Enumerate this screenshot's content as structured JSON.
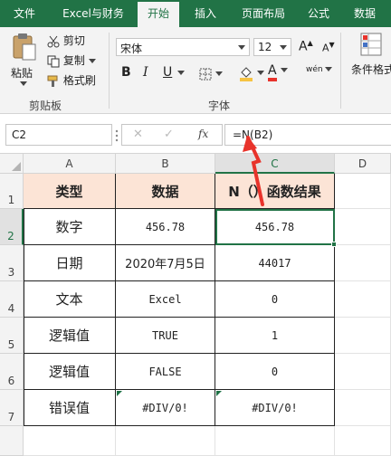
{
  "tabs": [
    "文件",
    "Excel与财务",
    "开始",
    "插入",
    "页面布局",
    "公式",
    "数据"
  ],
  "active_tab": "开始",
  "clipboard": {
    "paste_label": "粘贴",
    "cut_label": "剪切",
    "copy_label": "复制",
    "format_painter_label": "格式刷",
    "group_label": "剪贴板"
  },
  "font": {
    "font_name": "宋体",
    "font_size": "12",
    "grow_label": "A",
    "shrink_label": "A",
    "bold_label": "B",
    "italic_label": "I",
    "underline_label": "U",
    "font_color_label": "A",
    "phonetic_label": "wén",
    "group_label": "字体"
  },
  "styles": {
    "conditional_format_label": "条件格式"
  },
  "formula_bar": {
    "name_box": "C2",
    "cancel_label": "✕",
    "enter_label": "✓",
    "fx_label": "fx",
    "formula": "=N(B2)"
  },
  "columns": [
    "A",
    "B",
    "C",
    "D"
  ],
  "selected_column": "C",
  "rows": [
    "1",
    "2",
    "3",
    "4",
    "5",
    "6",
    "7"
  ],
  "selected_row": "2",
  "table": {
    "headers": [
      "类型",
      "数据",
      "N（）函数结果"
    ],
    "rows": [
      [
        "数字",
        "456.78",
        "456.78"
      ],
      [
        "日期",
        "2020年7月5日",
        "44017"
      ],
      [
        "文本",
        "Excel",
        "0"
      ],
      [
        "逻辑值",
        "TRUE",
        "1"
      ],
      [
        "逻辑值",
        "FALSE",
        "0"
      ],
      [
        "错误值",
        "#DIV/0!",
        "#DIV/0!"
      ]
    ]
  },
  "colors": {
    "accent": "#217346",
    "header_fill": "#fce4d6",
    "arrow": "#e8332b"
  }
}
